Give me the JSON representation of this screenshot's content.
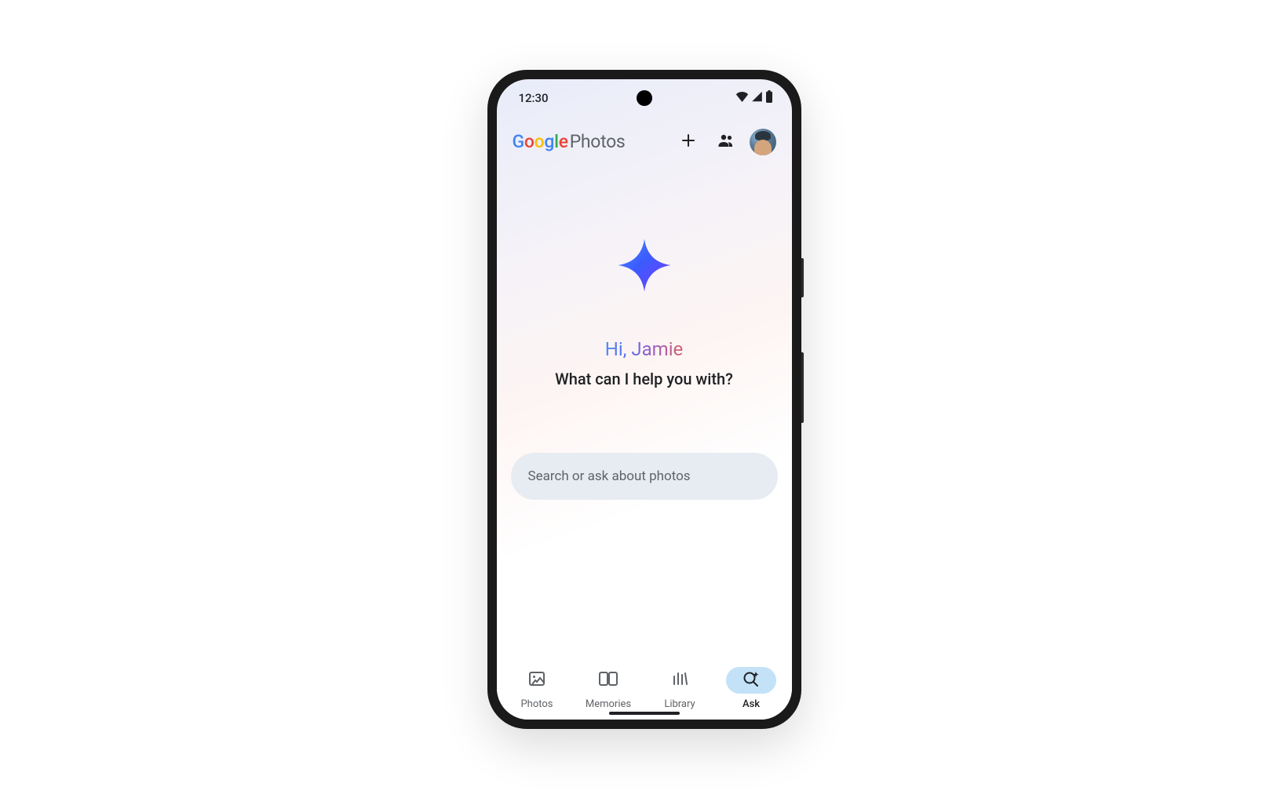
{
  "status_bar": {
    "time": "12:30",
    "icons": {
      "wifi": "wifi-icon",
      "cell": "cell-signal-icon",
      "battery": "battery-icon"
    }
  },
  "header": {
    "logo_brand": "Google",
    "logo_product": "Photos",
    "add_label": "Add",
    "shared_label": "Shared",
    "avatar_label": "Account"
  },
  "hero": {
    "greeting": "Hi, Jamie",
    "prompt": "What can I help you with?"
  },
  "search": {
    "placeholder": "Search or ask about photos"
  },
  "nav": {
    "items": [
      {
        "label": "Photos",
        "icon": "image-icon",
        "active": false
      },
      {
        "label": "Memories",
        "icon": "devices-icon",
        "active": false
      },
      {
        "label": "Library",
        "icon": "library-icon",
        "active": false
      },
      {
        "label": "Ask",
        "icon": "search-spark-icon",
        "active": true
      }
    ]
  },
  "colors": {
    "google_blue": "#4285F4",
    "google_red": "#EA4335",
    "google_yellow": "#FBBC05",
    "google_green": "#34A853",
    "active_pill": "#c3e2f7",
    "search_bg": "#e7ecf2"
  }
}
